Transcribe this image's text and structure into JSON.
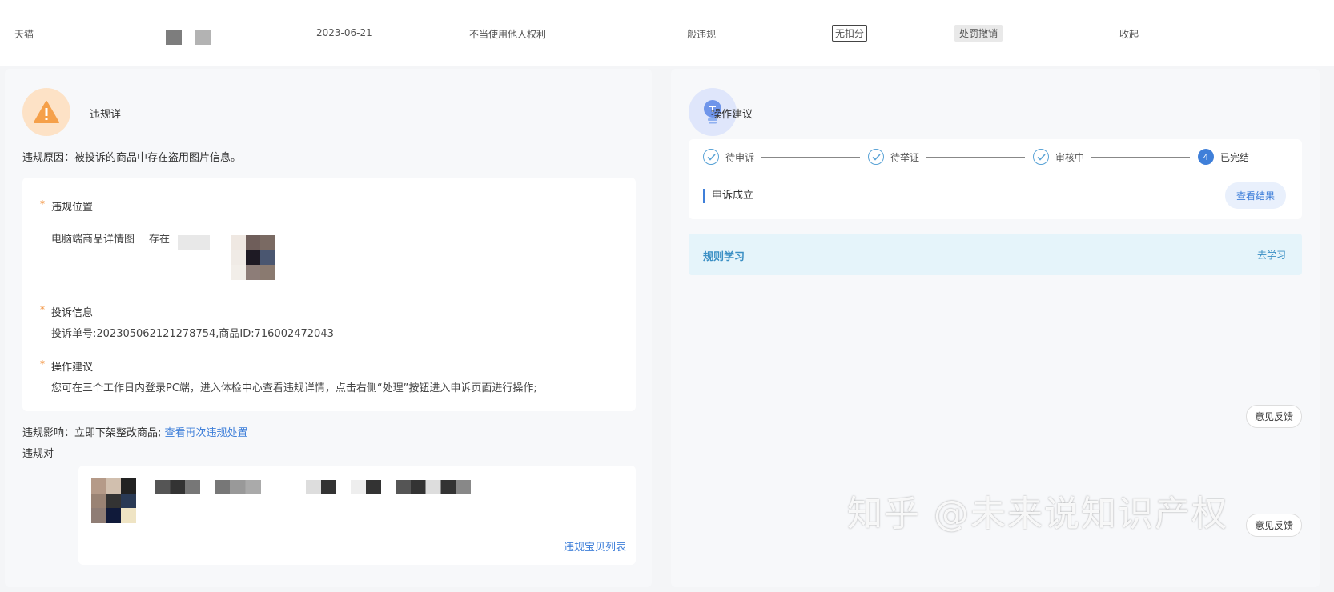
{
  "top": {
    "platform": "天猫",
    "date": "2023-06-21",
    "violation_type": "不当使用他人权利",
    "level": "一般违规",
    "points": "无扣分",
    "status": "处罚撤销",
    "collapse": "收起"
  },
  "left": {
    "title": "违规详",
    "reason_label": "违规原因：",
    "reason_text": "被投诉的商品中存在盗用图片信息。",
    "location_label": "违规位置",
    "location_text": "电脑端商品详情图",
    "location_extra": "存在",
    "complaint_label": "投诉信息",
    "complaint_text": "投诉单号:202305062121278754,商品ID:716002472043",
    "suggest_label": "操作建议",
    "suggest_text": "您可在三个工作日内登录PC端，进入体检中心查看违规详情，点击右侧“处理”按钮进入申诉页面进行操作;",
    "impact_label": "违规影响：",
    "impact_text": "立即下架整改商品;",
    "impact_link": "查看再次违规处置",
    "target_label": "违规对",
    "list_link": "违规宝贝列表"
  },
  "right": {
    "title": "操作建议",
    "steps": [
      "待申诉",
      "待举证",
      "审核中",
      "已完结"
    ],
    "final_step_num": "4",
    "result_text": "申诉成立",
    "result_btn": "查看结果",
    "study_title": "规则学习",
    "study_link": "去学习",
    "feedback": "意见反馈",
    "feedback2": "意见反馈"
  },
  "watermark": "知乎 @未来说知识产权",
  "colors": {
    "accent": "#3f7fd9",
    "warn": "#f28b30",
    "study_bg": "#e5f4fa"
  }
}
